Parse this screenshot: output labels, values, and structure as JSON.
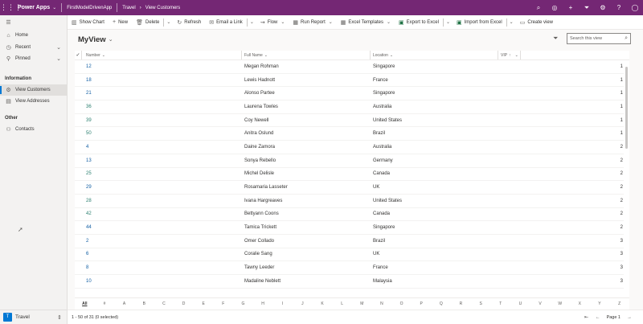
{
  "topbar": {
    "app_name": "Power Apps",
    "environment": "FirstModelDrivenApp",
    "breadcrumb": [
      "Travel",
      "View Customers"
    ],
    "icons": [
      "search-icon",
      "target-icon",
      "plus-icon",
      "filter-icon",
      "gear-icon",
      "help-icon",
      "user-icon"
    ]
  },
  "sidebar": {
    "nav": [
      {
        "label": "Home",
        "icon": "home-icon"
      },
      {
        "label": "Recent",
        "icon": "clock-icon",
        "expand": true
      },
      {
        "label": "Pinned",
        "icon": "pin-icon",
        "expand": true
      }
    ],
    "groups": [
      {
        "title": "Information",
        "items": [
          {
            "label": "View Customers",
            "icon": "gear-icon",
            "selected": true
          },
          {
            "label": "View Addresses",
            "icon": "table-icon",
            "selected": false
          }
        ]
      },
      {
        "title": "Other",
        "items": [
          {
            "label": "Contacts",
            "icon": "person-icon",
            "selected": false
          }
        ]
      }
    ],
    "area": {
      "badge": "T",
      "label": "Travel"
    }
  },
  "commands": [
    {
      "label": "Show Chart",
      "icon": "chart-icon"
    },
    {
      "label": "New",
      "icon": "plus-icon"
    },
    {
      "label": "Delete",
      "icon": "trash-icon",
      "chevron": true
    },
    {
      "label": "Refresh",
      "icon": "refresh-icon"
    },
    {
      "label": "Email a Link",
      "icon": "mail-icon",
      "chevron": true
    },
    {
      "label": "Flow",
      "icon": "flow-icon",
      "chevron": true
    },
    {
      "label": "Run Report",
      "icon": "report-icon",
      "chevron": true
    },
    {
      "label": "Excel Templates",
      "icon": "excel-icon",
      "chevron": true
    },
    {
      "label": "Export to Excel",
      "icon": "excel-icon",
      "chevron": true
    },
    {
      "label": "Import from Excel",
      "icon": "excel-icon",
      "chevron": true
    },
    {
      "label": "Create view",
      "icon": "view-icon"
    }
  ],
  "view": {
    "title": "MyView",
    "search_placeholder": "Search this view"
  },
  "grid": {
    "columns": [
      "Number",
      "Full Name",
      "Location",
      "VIP"
    ],
    "rows": [
      {
        "number": "12",
        "name": "Megan Rohman",
        "location": "Singapore",
        "vip": "1"
      },
      {
        "number": "18",
        "name": "Lewis Hadnott",
        "location": "France",
        "vip": "1"
      },
      {
        "number": "21",
        "name": "Alonso Partee",
        "location": "Singapore",
        "vip": "1"
      },
      {
        "number": "36",
        "name": "Laurena Towles",
        "location": "Australia",
        "vip": "1"
      },
      {
        "number": "39",
        "name": "Coy Newell",
        "location": "United States",
        "vip": "1"
      },
      {
        "number": "50",
        "name": "Anitra Oslund",
        "location": "Brazil",
        "vip": "1"
      },
      {
        "number": "4",
        "name": "Daine Zamora",
        "location": "Australia",
        "vip": "2"
      },
      {
        "number": "13",
        "name": "Sonya Rebello",
        "location": "Germany",
        "vip": "2"
      },
      {
        "number": "25",
        "name": "Michel Delisle",
        "location": "Canada",
        "vip": "2"
      },
      {
        "number": "29",
        "name": "Rosamaria Lasseter",
        "location": "UK",
        "vip": "2"
      },
      {
        "number": "28",
        "name": "Ivana Hargreaves",
        "location": "United States",
        "vip": "2"
      },
      {
        "number": "42",
        "name": "Bettyann Coons",
        "location": "Canada",
        "vip": "2"
      },
      {
        "number": "44",
        "name": "Tamica Trickett",
        "location": "Singapore",
        "vip": "2"
      },
      {
        "number": "2",
        "name": "Omer Collado",
        "location": "Brazil",
        "vip": "3"
      },
      {
        "number": "6",
        "name": "Coralie Sang",
        "location": "UK",
        "vip": "3"
      },
      {
        "number": "8",
        "name": "Tawny Leeder",
        "location": "France",
        "vip": "3"
      },
      {
        "number": "10",
        "name": "Madaline Neblett",
        "location": "Malaysia",
        "vip": "3"
      }
    ]
  },
  "jumpbar": [
    "All",
    "#",
    "A",
    "B",
    "C",
    "D",
    "E",
    "F",
    "G",
    "H",
    "I",
    "J",
    "K",
    "L",
    "M",
    "N",
    "O",
    "P",
    "Q",
    "R",
    "S",
    "T",
    "U",
    "V",
    "W",
    "X",
    "Y",
    "Z"
  ],
  "status": {
    "count_text": "1 - 50 of 31 (0 selected)",
    "page_label": "Page 1"
  },
  "colors": {
    "header": "#742774",
    "accent": "#0078d4",
    "link": "#115ea3"
  }
}
